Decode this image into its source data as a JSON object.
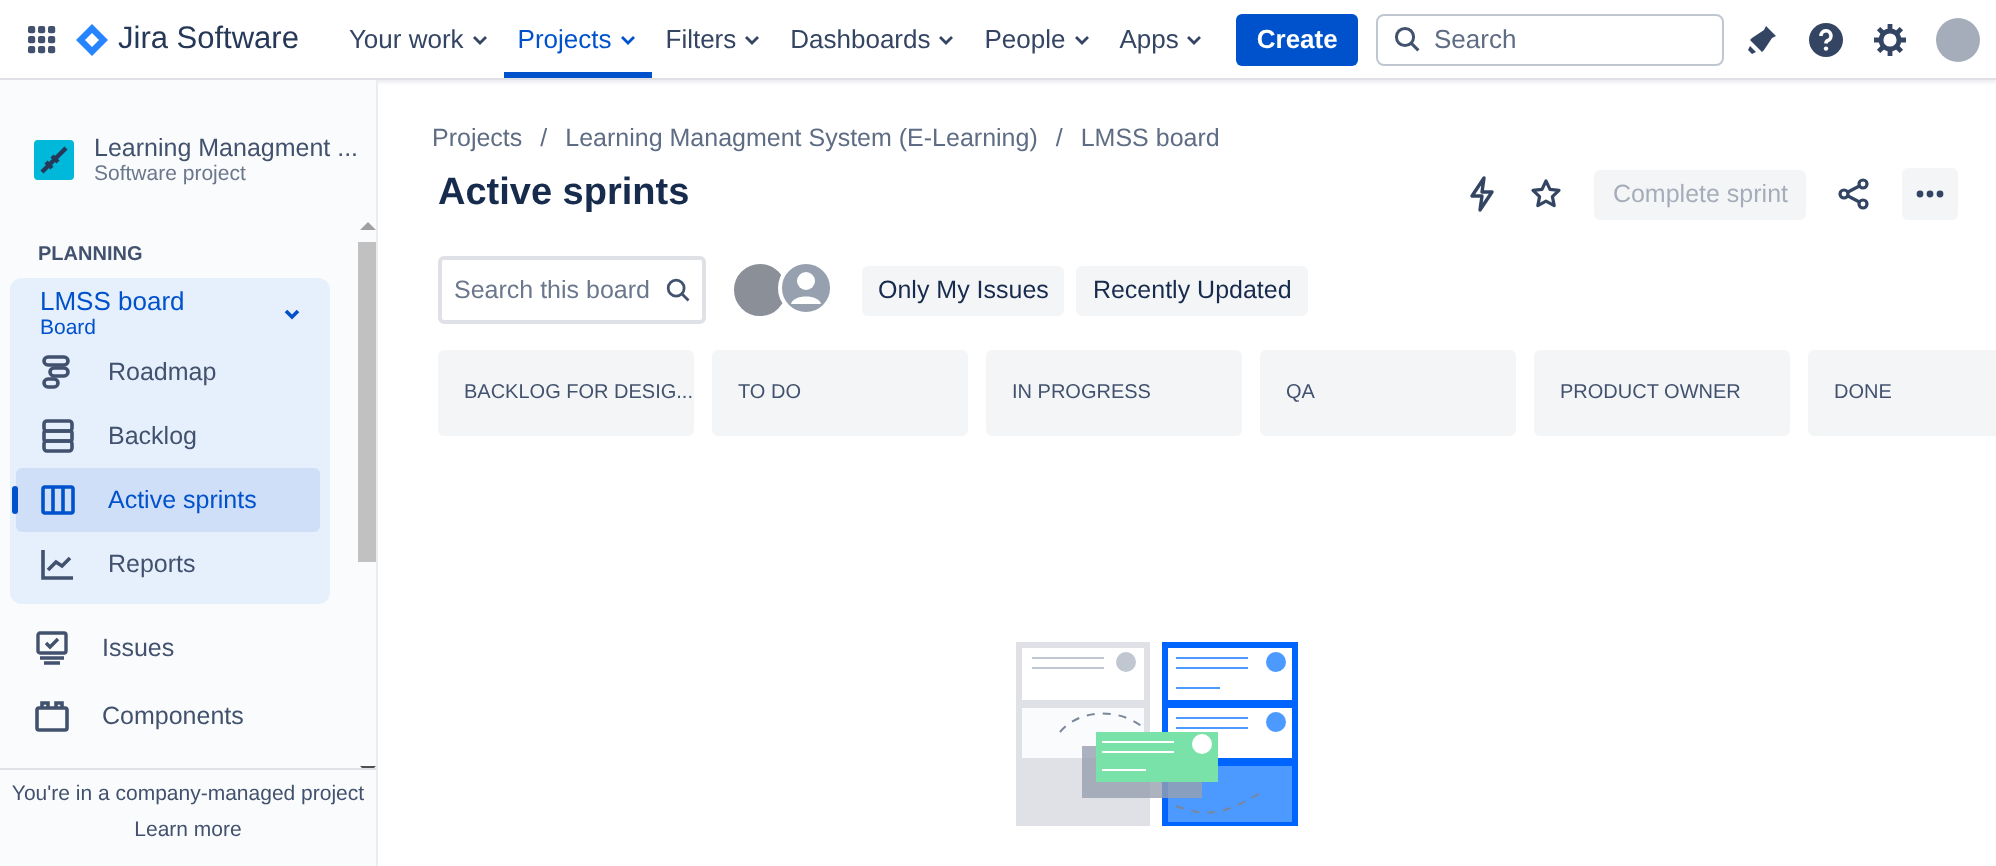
{
  "topnav": {
    "product": "Jira Software",
    "items": [
      {
        "label": "Your work",
        "selected": false
      },
      {
        "label": "Projects",
        "selected": true
      },
      {
        "label": "Filters",
        "selected": false
      },
      {
        "label": "Dashboards",
        "selected": false
      },
      {
        "label": "People",
        "selected": false
      },
      {
        "label": "Apps",
        "selected": false
      }
    ],
    "create": "Create",
    "search": {
      "placeholder": "Search"
    }
  },
  "sidebar": {
    "project": {
      "name": "Learning Managment ...",
      "type": "Software project"
    },
    "section": "PLANNING",
    "board": {
      "name": "LMSS board",
      "type": "Board",
      "expanded": true,
      "items": [
        {
          "label": "Roadmap",
          "kind": "roadmap",
          "selected": false
        },
        {
          "label": "Backlog",
          "kind": "backlog",
          "selected": false
        },
        {
          "label": "Active sprints",
          "kind": "board",
          "selected": true
        },
        {
          "label": "Reports",
          "kind": "reports",
          "selected": false
        }
      ]
    },
    "items": [
      {
        "label": "Issues",
        "kind": "issues",
        "selected": false
      },
      {
        "label": "Components",
        "kind": "components",
        "selected": false
      }
    ],
    "footer": {
      "text": "You're in a company-managed project",
      "link": "Learn more"
    }
  },
  "breadcrumbs": [
    {
      "label": "Projects"
    },
    {
      "separator": "/",
      "label": "Learning Managment System (E-Learning)"
    },
    {
      "separator": "/",
      "label": "LMSS board"
    }
  ],
  "title": "Active sprints",
  "complete_sprint": {
    "label": "Complete sprint",
    "disabled": true
  },
  "board_search": {
    "placeholder": "Search this board"
  },
  "filters": [
    "Only My Issues",
    "Recently Updated"
  ],
  "columns": [
    "BACKLOG FOR DESIG...",
    "TO DO",
    "IN PROGRESS",
    "QA",
    "PRODUCT OWNER",
    "DONE"
  ]
}
